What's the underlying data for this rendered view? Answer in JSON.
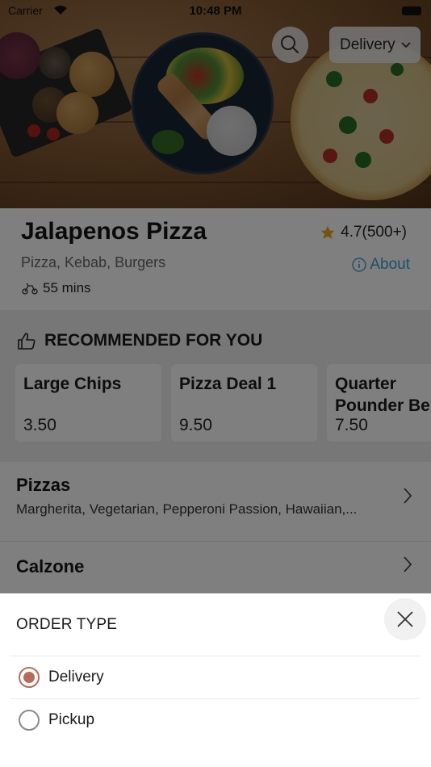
{
  "status_bar": {
    "carrier": "Carrier",
    "time": "10:48 PM"
  },
  "header": {
    "search_icon": "search-icon",
    "order_type_selected": "Delivery"
  },
  "restaurant": {
    "name": "Jalapenos Pizza",
    "rating": "4.7(500+)",
    "cuisine": "Pizza, Kebab, Burgers",
    "about_label": "About",
    "delivery_time": "55 mins"
  },
  "recommended": {
    "title": "RECOMMENDED FOR YOU",
    "items": [
      {
        "name": "Large Chips",
        "price": "3.50"
      },
      {
        "name": "Pizza Deal 1",
        "price": "9.50"
      },
      {
        "name": "Quarter Pounder Be",
        "price": "7.50"
      }
    ]
  },
  "categories": [
    {
      "name": "Pizzas",
      "description": "Margherita, Vegetarian, Pepperoni Passion, Hawaiian,..."
    },
    {
      "name": "Calzone",
      "description": ""
    }
  ],
  "order_sheet": {
    "title": "ORDER TYPE",
    "options": [
      {
        "label": "Delivery",
        "selected": true
      },
      {
        "label": "Pickup",
        "selected": false
      }
    ]
  },
  "colors": {
    "accent_link": "#3a9fd0",
    "radio_selected": "#b86a5a",
    "star": "#e9a617"
  }
}
